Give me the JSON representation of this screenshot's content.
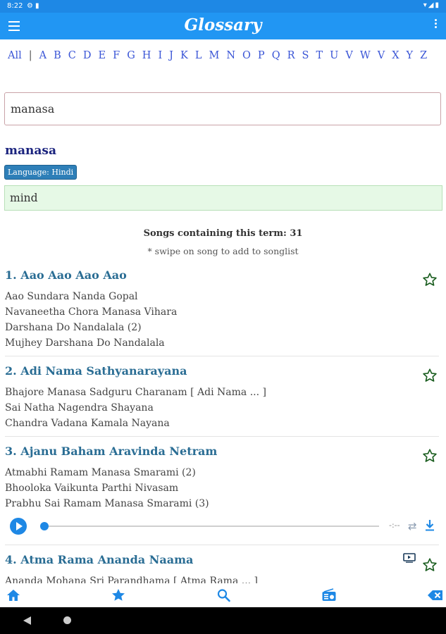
{
  "status": {
    "time": "8:22",
    "left_icons": [
      "settings-icon",
      "sd-card-icon"
    ],
    "right_icons": [
      "wifi-icon",
      "signal-icon",
      "battery-icon"
    ]
  },
  "appbar": {
    "title": "Glossary"
  },
  "alphabet": [
    "All",
    "|",
    "A",
    "B",
    "C",
    "D",
    "E",
    "F",
    "G",
    "H",
    "I",
    "J",
    "K",
    "L",
    "M",
    "N",
    "O",
    "P",
    "Q",
    "R",
    "S",
    "T",
    "U",
    "V",
    "W",
    "V",
    "X",
    "Y",
    "Z"
  ],
  "search": {
    "value": "manasa"
  },
  "term": {
    "word": "manasa",
    "language": "Language: Hindi",
    "meaning": "mind"
  },
  "results": {
    "count_text": "Songs containing this term: 31",
    "hint": "* swipe on song to add to songlist"
  },
  "songs": [
    {
      "title": "1. Aao Aao Aao Aao",
      "lines": [
        "Aao Sundara Nanda Gopal",
        "Navaneetha Chora Manasa Vihara",
        "Darshana Do Nandalala (2)",
        "Mujhey Darshana Do Nandalala"
      ]
    },
    {
      "title": "2. Adi Nama Sathyanarayana",
      "lines": [
        "Bhajore Manasa Sadguru Charanam [ Adi Nama ... ]",
        "Sai Natha Nagendra Shayana",
        "Chandra Vadana Kamala Nayana"
      ]
    },
    {
      "title": "3. Ajanu Baham Aravinda Netram",
      "lines": [
        "Atmabhi Ramam Manasa Smarami (2)",
        "Bhooloka Vaikunta Parthi Nivasam",
        "Prabhu Sai Ramam Manasa Smarami (3)"
      ]
    },
    {
      "title": "4. Atma Rama Ananda Naama",
      "lines": [
        "Ananda Mohana Sri Parandhama [ Atma Rama ... ]"
      ]
    }
  ],
  "player": {
    "time": "-:--",
    "progress": 0
  },
  "colors": {
    "appbar": "#2196f3",
    "statusbar": "#1e88e5",
    "song_title": "#2a6d94",
    "term": "#1a237e",
    "star": "#1b5e20",
    "meaning_bg": "#e6f9e6",
    "badge": "#2e7fb8"
  },
  "bottom_nav": [
    "home-icon",
    "star-icon",
    "search-icon",
    "radio-icon",
    "backspace-icon"
  ]
}
